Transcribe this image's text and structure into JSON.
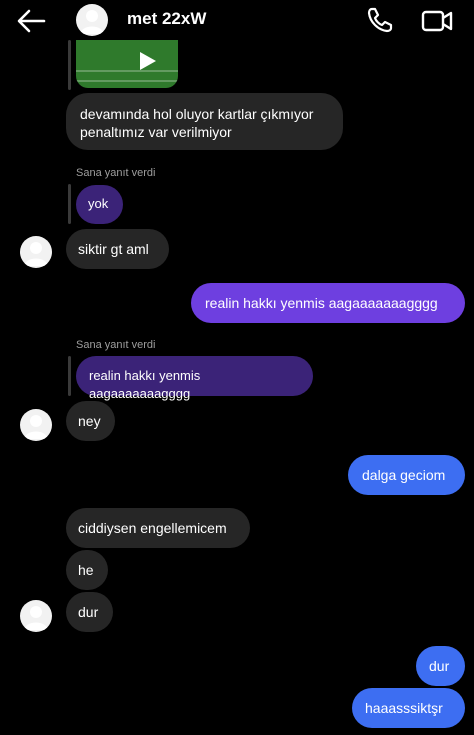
{
  "header": {
    "contact_name": "met 22xW",
    "icons": [
      "back-arrow-icon",
      "avatar",
      "phone-icon",
      "video-camera-icon"
    ]
  },
  "messages": [
    {
      "from": "them",
      "text": "devamında hol oluyor kartlar çıkmıyor\npenaltımız var verilmiyor"
    },
    {
      "from": "them",
      "reply_label": "Sana yanıt verdi",
      "quoted": "yok",
      "text": "siktir gt aml"
    },
    {
      "from": "me",
      "text": "realin hakkı yenmis aagaaaaaaagggg"
    },
    {
      "from": "them",
      "reply_label": "Sana yanıt verdi",
      "quoted": "realin hakkı yenmis aagaaaaaaagggg",
      "text": "ney"
    },
    {
      "from": "me",
      "text": "dalga geciom"
    },
    {
      "from": "them",
      "text": "ciddiysen engellemicem"
    },
    {
      "from": "them",
      "text": "he"
    },
    {
      "from": "them",
      "text": "dur"
    },
    {
      "from": "me",
      "text": "dur"
    },
    {
      "from": "me",
      "text": "haaasssiktşr"
    }
  ],
  "colors": {
    "background": "#000000",
    "incoming_bubble": "#262626",
    "outgoing_purple": "#6e3fe0",
    "outgoing_blue": "#3d6ef2",
    "quoted_bubble": "#3b2378"
  }
}
